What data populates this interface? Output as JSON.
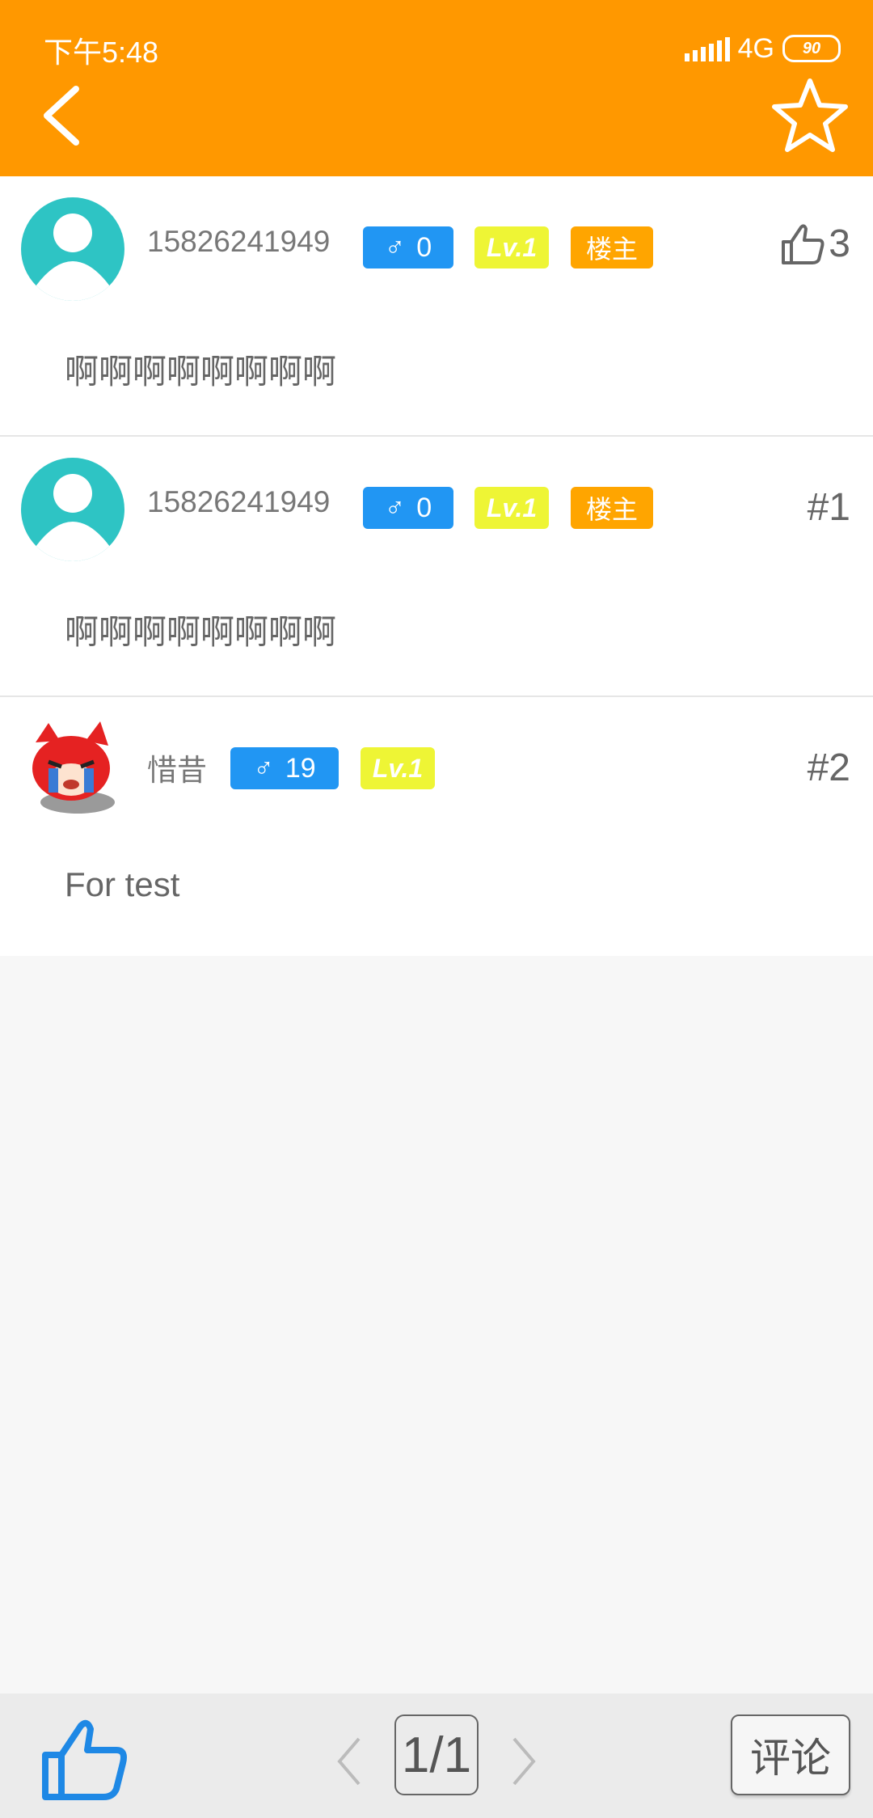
{
  "status_bar": {
    "time": "下午5:48",
    "network": "4G",
    "battery": "90"
  },
  "header": {
    "back_icon": "chevron-left-icon",
    "favorite_icon": "star-icon"
  },
  "posts": [
    {
      "username": "15826241949",
      "gender_symbol": "♂",
      "gender_count": "0",
      "level": "Lv.1",
      "owner_badge": "楼主",
      "likes": "3",
      "content": "啊啊啊啊啊啊啊啊"
    },
    {
      "username": "15826241949",
      "gender_symbol": "♂",
      "gender_count": "0",
      "level": "Lv.1",
      "owner_badge": "楼主",
      "floor": "#1",
      "content": "啊啊啊啊啊啊啊啊"
    },
    {
      "username": "惜昔",
      "gender_symbol": "♂",
      "gender_count": "19",
      "level": "Lv.1",
      "floor": "#2",
      "content": "For test"
    }
  ],
  "bottom_bar": {
    "page": "1/1",
    "comment_label": "评论"
  },
  "colors": {
    "header": "#ff9800",
    "gender_badge": "#2196f3",
    "level_badge": "#eef535",
    "owner_badge": "#ffa500",
    "avatar": "#2ec4c4",
    "like_icon": "#1e88e5"
  }
}
